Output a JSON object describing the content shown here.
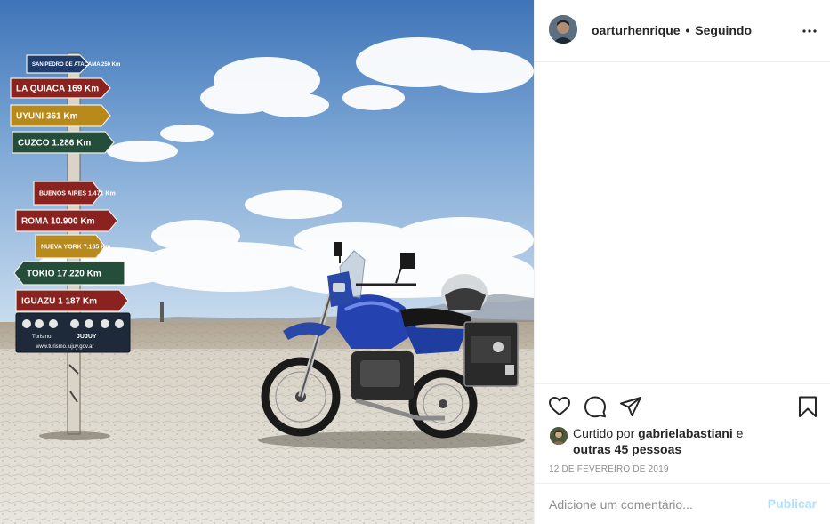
{
  "post": {
    "username": "oarturhenrique",
    "separator": "•",
    "follow_status": "Seguindo",
    "more_icon": "more-horizontal-icon"
  },
  "photo": {
    "signs": [
      {
        "text": "SAN PEDRO DE ATACAMA 250 Km",
        "color": "#1f3c6a"
      },
      {
        "text": "LA QUIACA 169 Km",
        "color": "#8a2320"
      },
      {
        "text": "UYUNI 361 Km",
        "color": "#b88a1c"
      },
      {
        "text": "CUZCO 1.286 Km",
        "color": "#244d3a"
      },
      {
        "text": "BUENOS AIRES 1.471 Km",
        "color": "#8a2320"
      },
      {
        "text": "ROMA 10.900 Km",
        "color": "#8a2320"
      },
      {
        "text": "NUEVA YORK 7.165 Km",
        "color": "#b88a1c"
      },
      {
        "text": "TOKIO 17.220 Km",
        "color": "#244d3a"
      },
      {
        "text": "IGUAZU 1 187 Km",
        "color": "#8a2320"
      }
    ],
    "board_footer": "www.turismo.jujuy.gov.ar",
    "board_logos": [
      "Turismo",
      "JUJUY"
    ]
  },
  "actions": {
    "like_icon": "heart-icon",
    "comment_icon": "comment-icon",
    "share_icon": "share-icon",
    "save_icon": "bookmark-icon"
  },
  "likes": {
    "prefix": "Curtido por",
    "user": "gabrielabastiani",
    "conjunction": "e",
    "others": "outras 45 pessoas"
  },
  "date": "12 DE FEVEREIRO DE 2019",
  "comment": {
    "placeholder": "Adicione um comentário...",
    "publish_label": "Publicar"
  },
  "colors": {
    "text": "#262626",
    "muted": "#8e8e8e",
    "border": "#efefef",
    "publish_disabled": "#b2dffc"
  }
}
